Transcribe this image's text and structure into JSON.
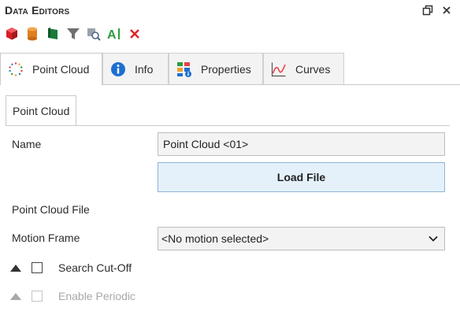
{
  "window": {
    "title": "Data Editors",
    "restore_icon": "restore-window-icon",
    "close_icon": "close-window-icon"
  },
  "toolbar": {
    "buttons": [
      {
        "name": "red-box-icon",
        "color": "#e0262b"
      },
      {
        "name": "orange-cylinder-icon",
        "color": "#e08a2a"
      },
      {
        "name": "green-flag-icon",
        "color": "#1d7a3a"
      },
      {
        "name": "filter-funnel-icon",
        "color": "#6e6e6e"
      },
      {
        "name": "find-reference-icon",
        "color": "#7a8aa0"
      },
      {
        "name": "rename-text-icon",
        "color": "#2f9a3f"
      },
      {
        "name": "delete-x-icon",
        "color": "#e0262b"
      }
    ]
  },
  "tabs": [
    {
      "label": "Point Cloud",
      "icon": "point-cloud-icon",
      "active": true
    },
    {
      "label": "Info",
      "icon": "info-icon",
      "active": false
    },
    {
      "label": "Properties",
      "icon": "properties-icon",
      "active": false
    },
    {
      "label": "Curves",
      "icon": "curves-icon",
      "active": false
    }
  ],
  "group": {
    "label": "Point Cloud"
  },
  "form": {
    "name_label": "Name",
    "name_value": "Point Cloud <01>",
    "load_button_label": "Load File",
    "file_label": "Point Cloud File",
    "motion_label": "Motion Frame",
    "motion_value": "<No motion selected>",
    "search_cutoff_label": "Search Cut-Off",
    "search_cutoff_checked": false,
    "enable_periodic_label": "Enable Periodic",
    "enable_periodic_checked": false,
    "enable_periodic_disabled": true
  },
  "colors": {
    "accent_button_bg": "#e4f1fb",
    "accent_button_border": "#8fb4d6",
    "input_bg": "#f3f3f3",
    "disabled_text": "#a8a8a8"
  }
}
